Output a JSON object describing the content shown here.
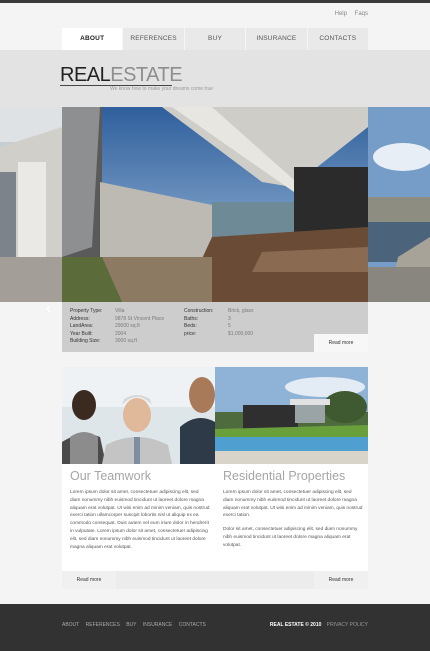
{
  "top_links": [
    "Help",
    "Faqs"
  ],
  "nav": [
    {
      "label": "ABOUT",
      "active": true
    },
    {
      "label": "REFERENCES",
      "active": false
    },
    {
      "label": "BUY",
      "active": false
    },
    {
      "label": "INSURANCE",
      "active": false
    },
    {
      "label": "CONTACTS",
      "active": false
    }
  ],
  "logo": {
    "part1": "REAL",
    "part2": "ESTATE",
    "tagline": "We know how to make your dreams come true"
  },
  "slider": {
    "prev_arrow": "‹"
  },
  "property": {
    "left": [
      {
        "label": "Property Type:",
        "value": "Villa"
      },
      {
        "label": "Address:",
        "value": "9878 St Vincent Place"
      },
      {
        "label": "LandArea:",
        "value": "29000 sq.ft"
      },
      {
        "label": "Year Built:",
        "value": "2004"
      },
      {
        "label": "Building Size:",
        "value": "3000 sq.ft"
      }
    ],
    "right": [
      {
        "label": "Construction:",
        "value": "Brick, glass"
      },
      {
        "label": "Baths:",
        "value": "3"
      },
      {
        "label": "Beds:",
        "value": "5"
      },
      {
        "label": "price:",
        "value": "$1,000,000"
      }
    ],
    "read_more": "Read more"
  },
  "columns": [
    {
      "title": "Our Teamwork",
      "paragraphs": [
        "Lorem ipsum dolor sit amet, consectetuer adipiscing elit, sed diam nonummy nibh euismod tincidunt ut laoreet dolore magna aliquam erat volutpat. Ut wisi enim ad minim veniam, quis nostrud exerci tation ullamcorper suscipit lobortis nisl ut aliquip ex ea commodo consequat. Duis autem vel eum iriure dolor in hendrerit in vulputate. Lorem ipsum dolor sit amet, consectetuer adipiscing elit, sed diam nonummy nibh euismod tincidunt ut laoreet dolore magna aliquam erat volutpat."
      ],
      "read_more": "Read more"
    },
    {
      "title": "Residential Properties",
      "paragraphs": [
        "Lorem ipsum dolor sit amet, consectetuer adipiscing elit, sed diam nonummy nibh euismod tincidunt ut laoreet dolore magna aliquam erat volutpat. Ut wisi enim ad minim veniam, quis nostrud exerci tation.",
        "Dolor sit amet, consectetuer adipiscing elit, sed diam nonummy nibh euismod tincidunt ut laoreet dolore magna aliquam erat volutpat."
      ],
      "read_more": "Read more"
    }
  ],
  "footer": {
    "links": [
      "ABOUT",
      "REFERENCES",
      "BUY",
      "INSURANCE",
      "CONTACTS"
    ],
    "brand": "REAL ESTATE © 2010",
    "privacy": "PRIVACY POLICY"
  }
}
